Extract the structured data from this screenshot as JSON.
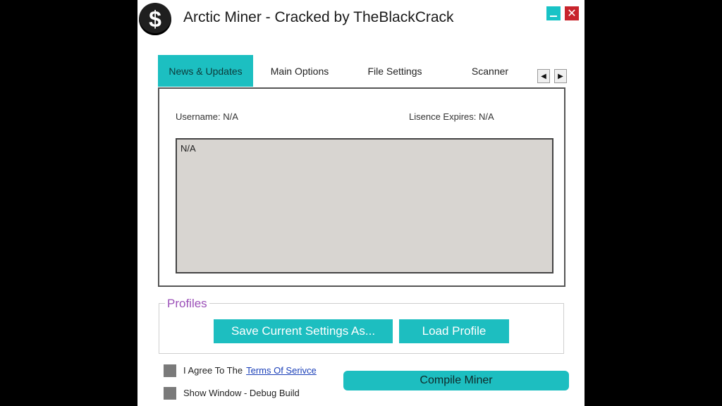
{
  "window": {
    "title": "Arctic Miner - Cracked by TheBlackCrack",
    "logo_glyph": "$",
    "close_glyph": "✕"
  },
  "tabs": [
    {
      "label": "News & Updates",
      "active": true
    },
    {
      "label": "Main Options",
      "active": false
    },
    {
      "label": "File Settings",
      "active": false
    },
    {
      "label": "Scanner",
      "active": false
    }
  ],
  "tab_scroll": {
    "left": "◀",
    "right": "▶"
  },
  "news": {
    "username": "Username: N/A",
    "licence": "Lisence Expires: N/A",
    "content": "N/A"
  },
  "profiles": {
    "legend": "Profiles",
    "save_label": "Save Current Settings As...",
    "load_label": "Load Profile"
  },
  "footer": {
    "agree_text": "I Agree To The",
    "tos_link": "Terms Of Serivce",
    "show_window": "Show Window - Debug Build",
    "compile_label": "Compile Miner"
  },
  "colors": {
    "accent": "#1dbec0",
    "close": "#c8242c",
    "legend": "#9b4fb8",
    "news_bg": "#d8d5d1"
  }
}
